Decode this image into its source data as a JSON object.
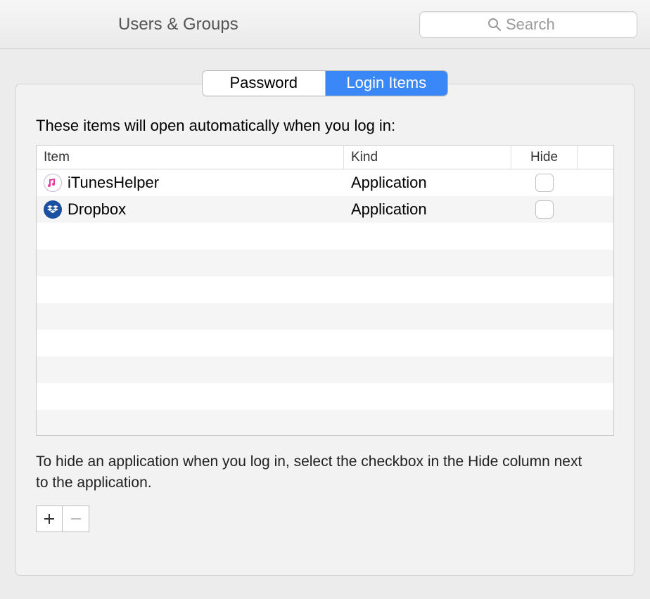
{
  "header": {
    "title": "Users & Groups",
    "search_placeholder": "Search"
  },
  "tabs": {
    "password": "Password",
    "login_items": "Login Items",
    "active": "login_items"
  },
  "description": "These items will open automatically when you log in:",
  "columns": {
    "item": "Item",
    "kind": "Kind",
    "hide": "Hide"
  },
  "rows": [
    {
      "icon": "itunes-icon",
      "name": "iTunesHelper",
      "kind": "Application",
      "hide": false
    },
    {
      "icon": "dropbox-icon",
      "name": "Dropbox",
      "kind": "Application",
      "hide": false
    }
  ],
  "hint": "To hide an application when you log in, select the checkbox in the Hide column next to the application.",
  "buttons": {
    "add": "+",
    "remove": "−"
  }
}
